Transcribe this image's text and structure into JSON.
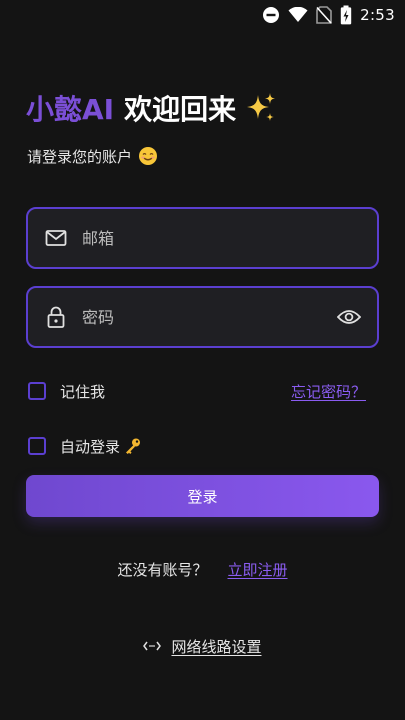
{
  "status_bar": {
    "time": "2:53",
    "icons": [
      "do-not-disturb-icon",
      "wifi-icon",
      "no-sim-icon",
      "battery-charging-icon"
    ]
  },
  "header": {
    "brand": "小懿AI",
    "welcome": "欢迎回来",
    "sparkle_icon": "sparkles-emoji",
    "subtitle": "请登录您的账户",
    "subtitle_emoji": "smiling-face-emoji"
  },
  "form": {
    "email": {
      "placeholder": "邮箱",
      "value": "",
      "icon": "mail-icon"
    },
    "password": {
      "placeholder": "密码",
      "value": "",
      "icon": "lock-icon",
      "toggle_icon": "eye-icon"
    },
    "remember_me": {
      "label": "记住我",
      "checked": false
    },
    "forgot_password": "忘记密码？",
    "auto_login": {
      "label": "自动登录",
      "checked": false,
      "icon": "key-emoji"
    },
    "login_button": "登录"
  },
  "register": {
    "question": "还没有账号？",
    "link": "立即注册"
  },
  "network": {
    "label": "网络线路设置",
    "icon": "code-brackets-icon"
  },
  "colors": {
    "background": "#141414",
    "accent": "#7b4fd6",
    "field_border": "#5b3fd0",
    "field_bg": "#1f1f23",
    "link": "#8a5cf0"
  }
}
